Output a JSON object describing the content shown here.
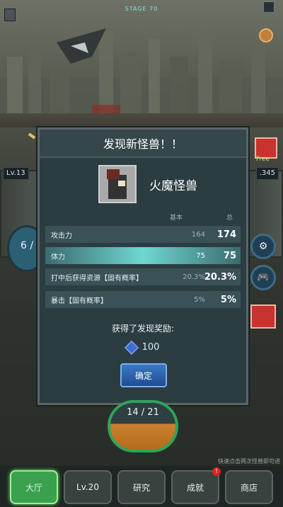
{
  "hud": {
    "stage_label": "STAGE 70",
    "level_left": "Lv.13",
    "level_right": ".345",
    "free_label": "Free",
    "gauge_left_value": "6 /"
  },
  "dialog": {
    "title": "发现新怪兽！！",
    "monster_name": "火魔怪兽",
    "col_base": "基本",
    "col_total": "总",
    "stats": [
      {
        "name": "攻击力",
        "base": "164",
        "total": "174"
      },
      {
        "name": "体力",
        "base": "75",
        "total": "75"
      },
      {
        "name": "打中后获得资源【固有概率】",
        "base": "20.3%",
        "total": "20.3%"
      },
      {
        "name": "暴击【固有概率】",
        "base": "5%",
        "total": "5%"
      }
    ],
    "reward_title": "获得了发现奖励:",
    "reward_value": "100",
    "confirm_label": "确定"
  },
  "bottom_gauge": {
    "current": "14",
    "max": "21",
    "display": "14 / 21"
  },
  "hint_text": "快速点击两次怪兽即可进",
  "nav": [
    {
      "label": "大厅",
      "active": true
    },
    {
      "label": "Lv.20"
    },
    {
      "label": "研究"
    },
    {
      "label": "成就",
      "badge": "!"
    },
    {
      "label": "商店"
    }
  ],
  "colors": {
    "accent": "#6fd7d1",
    "button": "#2f63ad",
    "active_nav": "#3aa14e"
  }
}
